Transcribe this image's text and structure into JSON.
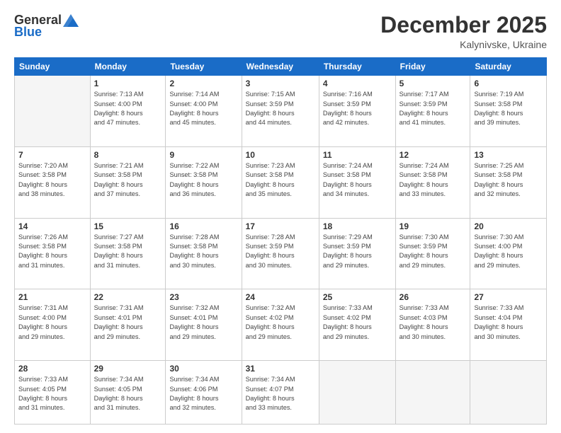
{
  "header": {
    "logo_general": "General",
    "logo_blue": "Blue",
    "month_title": "December 2025",
    "location": "Kalynivske, Ukraine"
  },
  "weekdays": [
    "Sunday",
    "Monday",
    "Tuesday",
    "Wednesday",
    "Thursday",
    "Friday",
    "Saturday"
  ],
  "weeks": [
    [
      {
        "day": "",
        "info": ""
      },
      {
        "day": "1",
        "info": "Sunrise: 7:13 AM\nSunset: 4:00 PM\nDaylight: 8 hours\nand 47 minutes."
      },
      {
        "day": "2",
        "info": "Sunrise: 7:14 AM\nSunset: 4:00 PM\nDaylight: 8 hours\nand 45 minutes."
      },
      {
        "day": "3",
        "info": "Sunrise: 7:15 AM\nSunset: 3:59 PM\nDaylight: 8 hours\nand 44 minutes."
      },
      {
        "day": "4",
        "info": "Sunrise: 7:16 AM\nSunset: 3:59 PM\nDaylight: 8 hours\nand 42 minutes."
      },
      {
        "day": "5",
        "info": "Sunrise: 7:17 AM\nSunset: 3:59 PM\nDaylight: 8 hours\nand 41 minutes."
      },
      {
        "day": "6",
        "info": "Sunrise: 7:19 AM\nSunset: 3:58 PM\nDaylight: 8 hours\nand 39 minutes."
      }
    ],
    [
      {
        "day": "7",
        "info": "Sunrise: 7:20 AM\nSunset: 3:58 PM\nDaylight: 8 hours\nand 38 minutes."
      },
      {
        "day": "8",
        "info": "Sunrise: 7:21 AM\nSunset: 3:58 PM\nDaylight: 8 hours\nand 37 minutes."
      },
      {
        "day": "9",
        "info": "Sunrise: 7:22 AM\nSunset: 3:58 PM\nDaylight: 8 hours\nand 36 minutes."
      },
      {
        "day": "10",
        "info": "Sunrise: 7:23 AM\nSunset: 3:58 PM\nDaylight: 8 hours\nand 35 minutes."
      },
      {
        "day": "11",
        "info": "Sunrise: 7:24 AM\nSunset: 3:58 PM\nDaylight: 8 hours\nand 34 minutes."
      },
      {
        "day": "12",
        "info": "Sunrise: 7:24 AM\nSunset: 3:58 PM\nDaylight: 8 hours\nand 33 minutes."
      },
      {
        "day": "13",
        "info": "Sunrise: 7:25 AM\nSunset: 3:58 PM\nDaylight: 8 hours\nand 32 minutes."
      }
    ],
    [
      {
        "day": "14",
        "info": "Sunrise: 7:26 AM\nSunset: 3:58 PM\nDaylight: 8 hours\nand 31 minutes."
      },
      {
        "day": "15",
        "info": "Sunrise: 7:27 AM\nSunset: 3:58 PM\nDaylight: 8 hours\nand 31 minutes."
      },
      {
        "day": "16",
        "info": "Sunrise: 7:28 AM\nSunset: 3:58 PM\nDaylight: 8 hours\nand 30 minutes."
      },
      {
        "day": "17",
        "info": "Sunrise: 7:28 AM\nSunset: 3:59 PM\nDaylight: 8 hours\nand 30 minutes."
      },
      {
        "day": "18",
        "info": "Sunrise: 7:29 AM\nSunset: 3:59 PM\nDaylight: 8 hours\nand 29 minutes."
      },
      {
        "day": "19",
        "info": "Sunrise: 7:30 AM\nSunset: 3:59 PM\nDaylight: 8 hours\nand 29 minutes."
      },
      {
        "day": "20",
        "info": "Sunrise: 7:30 AM\nSunset: 4:00 PM\nDaylight: 8 hours\nand 29 minutes."
      }
    ],
    [
      {
        "day": "21",
        "info": "Sunrise: 7:31 AM\nSunset: 4:00 PM\nDaylight: 8 hours\nand 29 minutes."
      },
      {
        "day": "22",
        "info": "Sunrise: 7:31 AM\nSunset: 4:01 PM\nDaylight: 8 hours\nand 29 minutes."
      },
      {
        "day": "23",
        "info": "Sunrise: 7:32 AM\nSunset: 4:01 PM\nDaylight: 8 hours\nand 29 minutes."
      },
      {
        "day": "24",
        "info": "Sunrise: 7:32 AM\nSunset: 4:02 PM\nDaylight: 8 hours\nand 29 minutes."
      },
      {
        "day": "25",
        "info": "Sunrise: 7:33 AM\nSunset: 4:02 PM\nDaylight: 8 hours\nand 29 minutes."
      },
      {
        "day": "26",
        "info": "Sunrise: 7:33 AM\nSunset: 4:03 PM\nDaylight: 8 hours\nand 30 minutes."
      },
      {
        "day": "27",
        "info": "Sunrise: 7:33 AM\nSunset: 4:04 PM\nDaylight: 8 hours\nand 30 minutes."
      }
    ],
    [
      {
        "day": "28",
        "info": "Sunrise: 7:33 AM\nSunset: 4:05 PM\nDaylight: 8 hours\nand 31 minutes."
      },
      {
        "day": "29",
        "info": "Sunrise: 7:34 AM\nSunset: 4:05 PM\nDaylight: 8 hours\nand 31 minutes."
      },
      {
        "day": "30",
        "info": "Sunrise: 7:34 AM\nSunset: 4:06 PM\nDaylight: 8 hours\nand 32 minutes."
      },
      {
        "day": "31",
        "info": "Sunrise: 7:34 AM\nSunset: 4:07 PM\nDaylight: 8 hours\nand 33 minutes."
      },
      {
        "day": "",
        "info": ""
      },
      {
        "day": "",
        "info": ""
      },
      {
        "day": "",
        "info": ""
      }
    ]
  ]
}
